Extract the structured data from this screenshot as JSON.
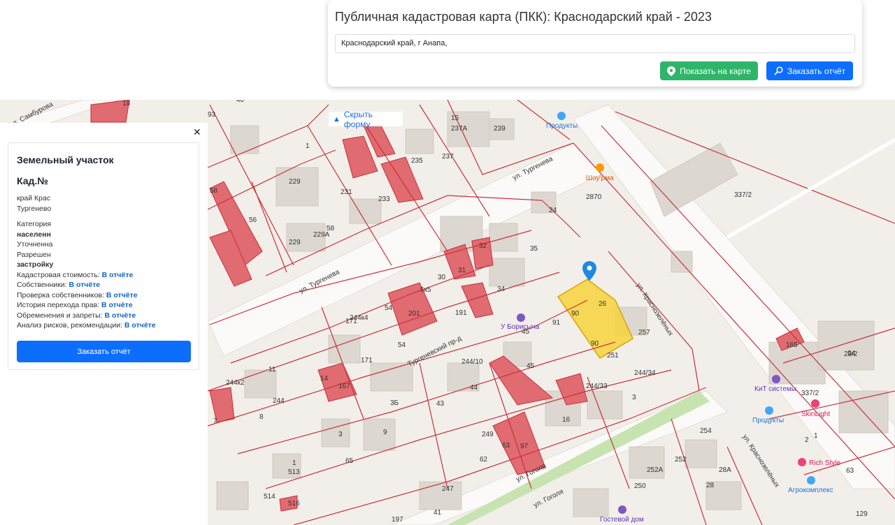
{
  "header": {
    "title": "Публичная кадастровая карта (ПКК): Краснодарский край - 2023",
    "address_value": "Краснодарский край, г Анапа,",
    "show_on_map_label": "Показать на карте",
    "order_report_label": "Заказать отчёт"
  },
  "map_controls": {
    "hide_form_label": "Скрыть форму"
  },
  "panel": {
    "close_symbol": "✕",
    "title": "Земельный участок",
    "kad_label": "Кад.№",
    "address_line1": "край Крас",
    "address_line2": "Тургенево",
    "category_label": "Категория",
    "category_value": "населенн",
    "clarified_label": "Уточненна",
    "permitted_label": "Разрешен",
    "permitted_value": "застройку",
    "rows": [
      {
        "label": "Кадастровая стоимость:",
        "link": "В отчёте"
      },
      {
        "label": "Собственники:",
        "link": "В отчёте"
      },
      {
        "label": "Проверка собственников:",
        "link": "В отчёте"
      },
      {
        "label": "История перехода прав:",
        "link": "В отчёте"
      },
      {
        "label": "Обременения и запреты:",
        "link": "В отчёте"
      },
      {
        "label": "Анализ рисков, рекомендации:",
        "link": "В отчёте"
      }
    ],
    "order_button_label": "Заказать отчёт"
  },
  "map_labels": {
    "streets": [
      "ул. Тургенева",
      "ул. Тургенева",
      "Тургеневский пр-д",
      "ул. Краснозелёных",
      "ул. Краснозелёных",
      "ул. Гоголя",
      "ул. Гоголя",
      "л. Самбурова"
    ],
    "pois": [
      "Продукты",
      "Шоу'рма",
      "У Борисыча",
      "КиТ системы",
      "Продукты",
      "SkinLight",
      "Rich Style",
      "Агрокомплекс",
      "Гостевой дом"
    ],
    "numbers": [
      "18",
      "93",
      "40",
      "1",
      "15",
      "237А",
      "239",
      "235",
      "237",
      "231",
      "233",
      "229",
      "58",
      "229",
      "229А",
      "58",
      "56",
      "24",
      "32",
      "35",
      "5к5",
      "30",
      "31",
      "34",
      "201",
      "191",
      "54",
      "244к4",
      "171",
      "54",
      "45",
      "91",
      "26",
      "90",
      "90",
      "251",
      "257",
      "337/2",
      "24",
      "244/10",
      "44",
      "171",
      "45",
      "244/33",
      "244/34",
      "3",
      "3Б",
      "43",
      "16",
      "249",
      "63",
      "97",
      "62",
      "244к2",
      "244",
      "11",
      "8",
      "7",
      "14",
      "167",
      "3",
      "9",
      "65",
      "1",
      "513",
      "514",
      "516",
      "252А",
      "252",
      "254",
      "28А",
      "28",
      "250",
      "247",
      "197",
      "41",
      "129",
      "63",
      "29/2",
      "337/2",
      "165",
      "1",
      "2",
      "2870"
    ]
  },
  "colors": {
    "accent_blue": "#0d6efd",
    "accent_green": "#2fb56a",
    "parcel_line": "#c9313a",
    "highlight_fill": "#f7d23c",
    "red_building": "#e06b70"
  }
}
